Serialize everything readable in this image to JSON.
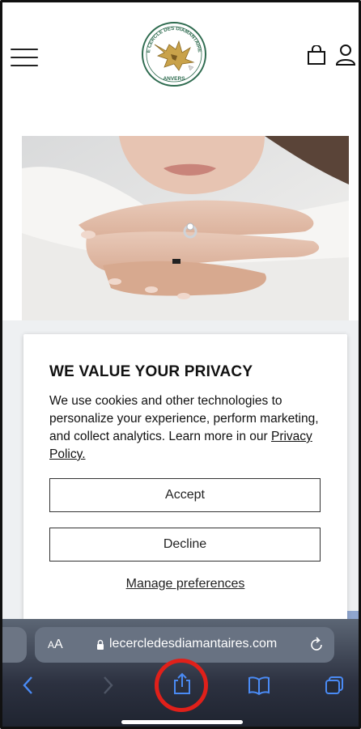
{
  "header": {
    "logo_text_top": "LE CERCLE DES DIAMANTAIRES",
    "logo_text_bottom": "ANVERS"
  },
  "modal": {
    "title": "WE VALUE YOUR PRIVACY",
    "body": "We use cookies and other technologies to personalize your experience, perform marketing, and collect analytics. Learn more in our ",
    "policy_link": "Privacy Policy.",
    "accept_label": "Accept",
    "decline_label": "Decline",
    "manage_label": "Manage preferences"
  },
  "browser": {
    "text_size_label_small": "A",
    "text_size_label_large": "A",
    "url": "lecercledesdiamantaires.com"
  },
  "colors": {
    "highlight": "#e0201a",
    "logo_gold": "#c9a24a",
    "logo_green": "#2e6b4f",
    "browser_icon_blue": "#4a8bf5"
  }
}
